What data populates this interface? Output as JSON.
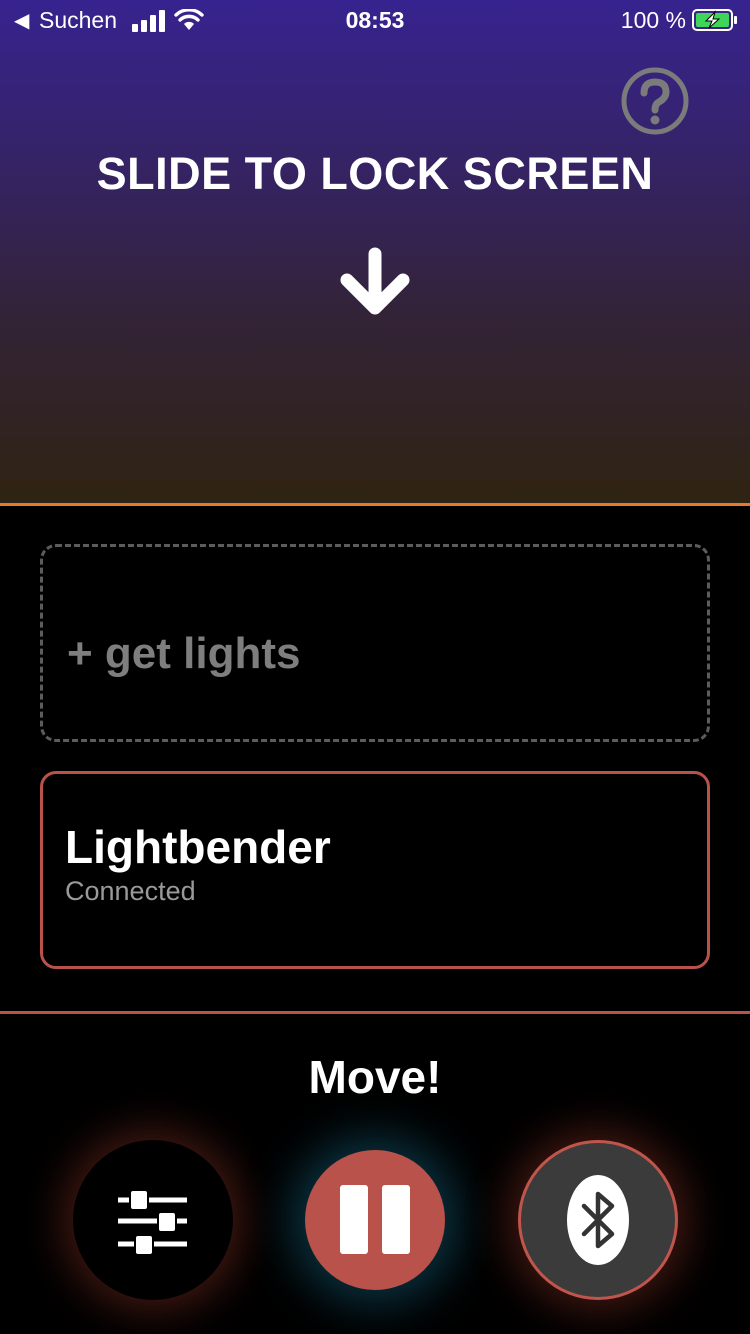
{
  "status_bar": {
    "back_label": "Suchen",
    "time": "08:53",
    "battery_percent": "100 %",
    "icons": [
      "back-arrow-icon",
      "signal-icon",
      "wifi-icon",
      "battery-charging-icon"
    ]
  },
  "header": {
    "title": "SLIDE TO LOCK SCREEN",
    "icons": [
      "help-icon",
      "arrow-down-icon"
    ]
  },
  "lights": {
    "get_lights_label": "+ get lights",
    "devices": [
      {
        "name": "Lightbender",
        "status": "Connected"
      }
    ]
  },
  "footer": {
    "label": "Move!",
    "buttons": [
      "sliders-icon",
      "pause-icon",
      "bluetooth-icon"
    ]
  },
  "colors": {
    "accent_orange": "#e9772c",
    "accent_red": "#b8524a",
    "background": "#000000",
    "gradient_top": "#37238f",
    "gradient_bottom": "#2f2312"
  }
}
